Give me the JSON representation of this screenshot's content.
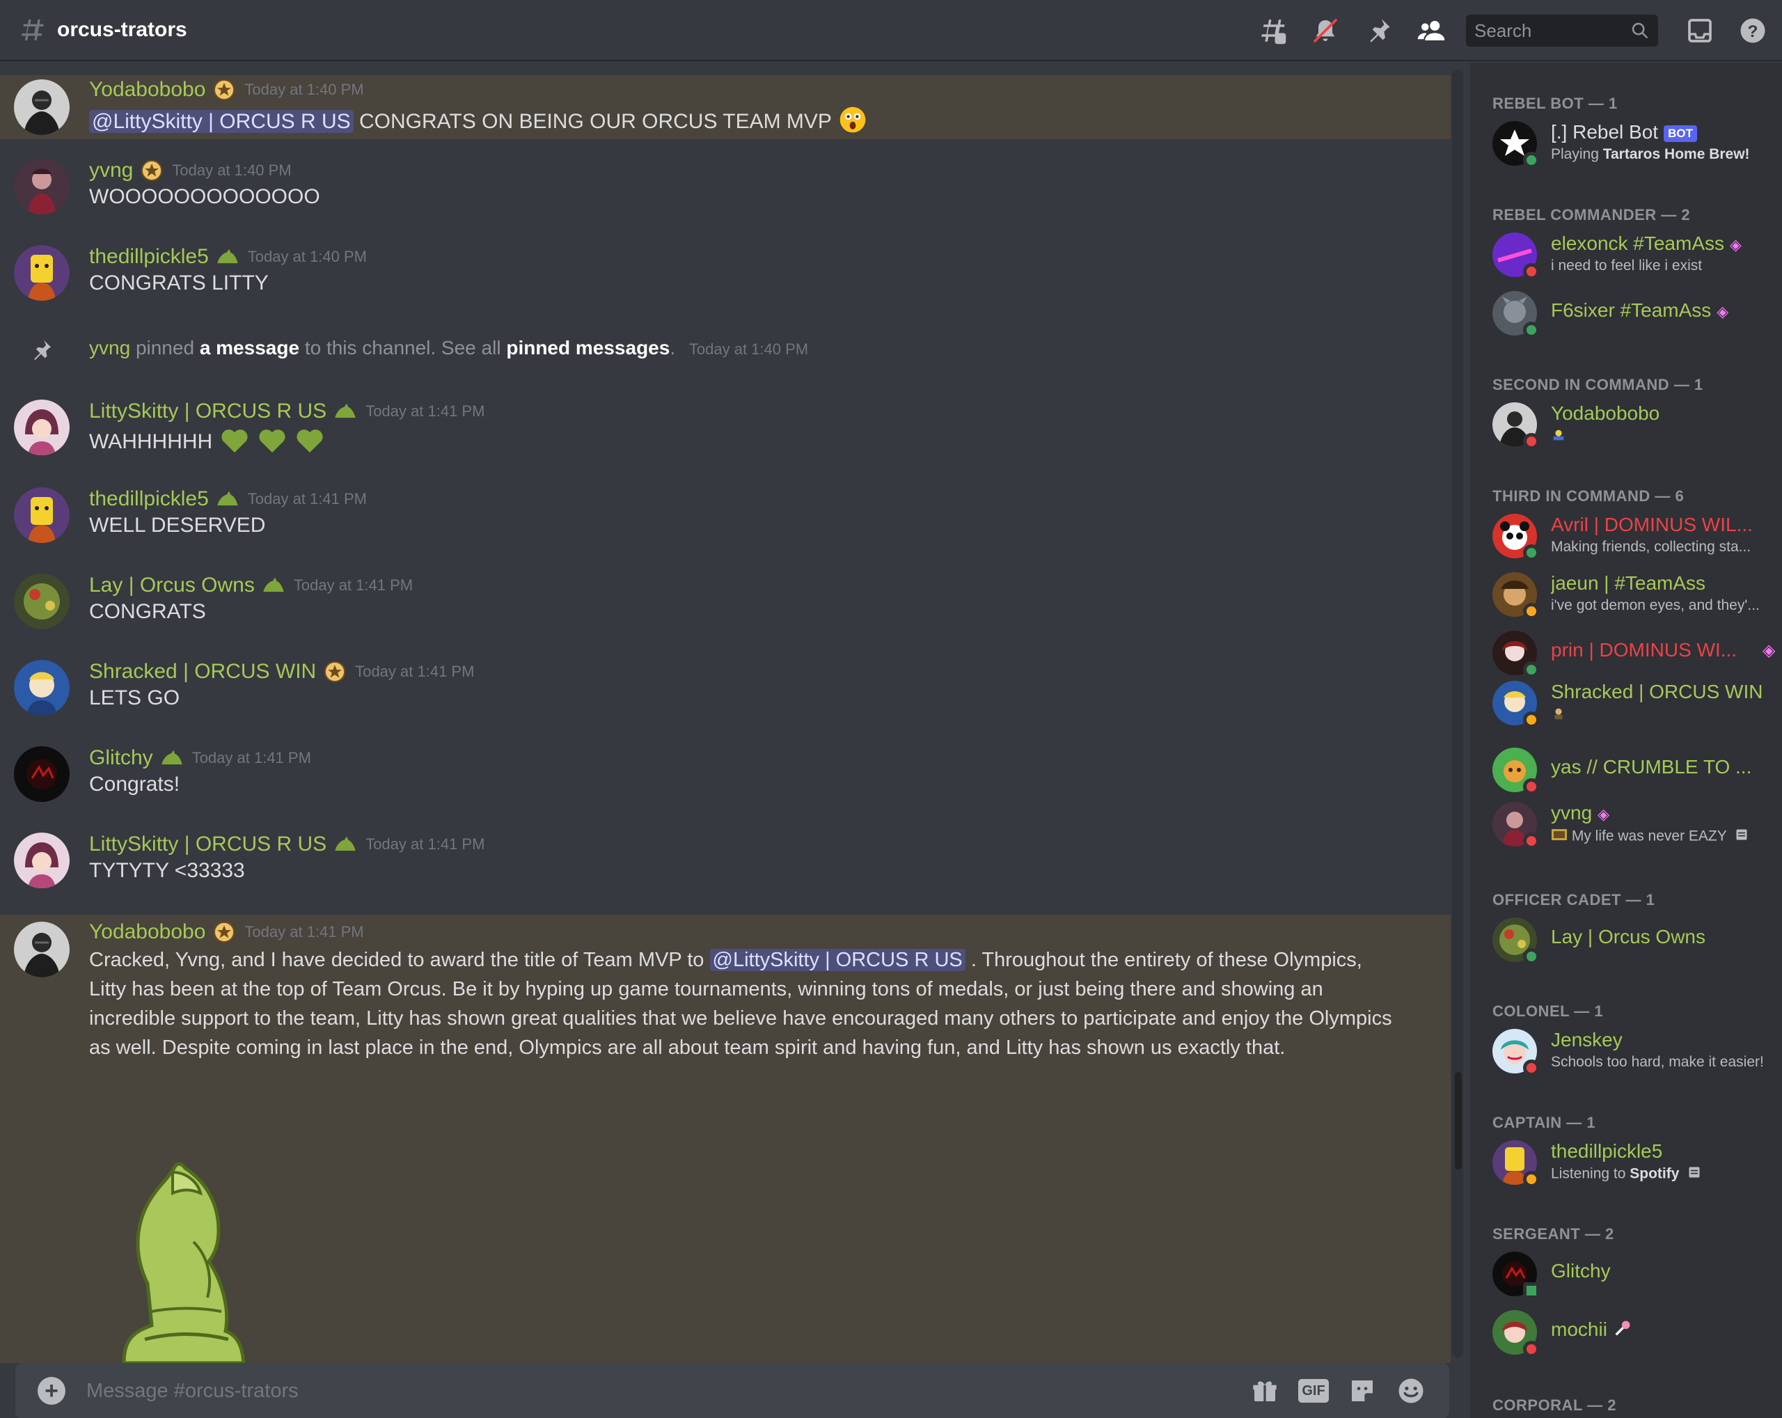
{
  "header": {
    "channel_name": "orcus-trators",
    "search_placeholder": "Search"
  },
  "messages": [
    {
      "author": "Yodabobobo",
      "time": "Today at 1:40 PM",
      "mention": "@LittySkitty | ORCUS R US",
      "text": "CONGRATS ON BEING OUR ORCUS TEAM MVP"
    },
    {
      "author": "yvng",
      "time": "Today at 1:40 PM",
      "text": "WOOOOOOOOOOOOO"
    },
    {
      "author": "thedillpickle5",
      "time": "Today at 1:40 PM",
      "text": "CONGRATS LITTY"
    },
    {
      "author": "LittySkitty | ORCUS R US",
      "time": "Today at 1:41 PM",
      "text": "WAHHHHHH"
    },
    {
      "author": "thedillpickle5",
      "time": "Today at 1:41 PM",
      "text": "WELL DESERVED"
    },
    {
      "author": "Lay | Orcus Owns",
      "time": "Today at 1:41 PM",
      "text": "CONGRATS"
    },
    {
      "author": "Shracked | ORCUS WIN",
      "time": "Today at 1:41 PM",
      "text": "LETS GO"
    },
    {
      "author": "Glitchy",
      "time": "Today at 1:41 PM",
      "text": "Congrats!"
    },
    {
      "author": "LittySkitty | ORCUS R US",
      "time": "Today at 1:41 PM",
      "text": "TYTYTY <33333"
    },
    {
      "author": "Yodabobobo",
      "time": "Today at 1:41 PM",
      "text_before": "Cracked, Yvng, and I have decided to award the title of Team MVP to",
      "mention": "@LittySkitty | ORCUS R US",
      "text_after": ". Throughout the entirety of these Olympics, Litty has been at the top of Team Orcus. Be it by hyping up game tournaments, winning tons of medals, or just being there and showing an incredible support to the team, Litty has shown great qualities that we believe have encouraged many others to participate and enjoy the Olympics as well. Despite coming in last place in the end, Olympics are all about team spirit and having fun, and Litty has shown us exactly that."
    }
  ],
  "pin_notice": {
    "user": "yvng",
    "w1": "pinned",
    "link1": "a message",
    "w2": "to this channel. See all",
    "link2": "pinned messages",
    "w3": ".",
    "time": "Today at 1:40 PM"
  },
  "composer": {
    "placeholder": "Message #orcus-trators",
    "gif_label": "GIF"
  },
  "member_groups": [
    {
      "label": "REBEL BOT — 1",
      "members": [
        {
          "name": "[.] Rebel Bot",
          "badge": "BOT",
          "sub_prefix": "Playing ",
          "sub_bold": "Tartaros Home Brew!"
        }
      ]
    },
    {
      "label": "REBEL COMMANDER — 2",
      "members": [
        {
          "name": "elexonck #TeamAss",
          "sub": "i need to feel like i exist"
        },
        {
          "name": "F6sixer #TeamAss"
        }
      ]
    },
    {
      "label": "SECOND IN COMMAND — 1",
      "members": [
        {
          "name": "Yodabobobo"
        }
      ]
    },
    {
      "label": "THIRD IN COMMAND — 6",
      "members": [
        {
          "name": "Avril | DOMINUS WIL...",
          "sub": "Making friends, collecting sta..."
        },
        {
          "name": "jaeun | #TeamAss",
          "sub": "i've got demon eyes, and they'..."
        },
        {
          "name": "prin | DOMINUS WI..."
        },
        {
          "name": "Shracked | ORCUS WIN"
        },
        {
          "name": "yas // CRUMBLE TO ..."
        },
        {
          "name": "yvng",
          "sub": "My life was never EAZY"
        }
      ]
    },
    {
      "label": "OFFICER CADET — 1",
      "members": [
        {
          "name": "Lay | Orcus Owns"
        }
      ]
    },
    {
      "label": "COLONEL — 1",
      "members": [
        {
          "name": "Jenskey",
          "sub": "Schools too hard, make it easier!"
        }
      ]
    },
    {
      "label": "CAPTAIN — 1",
      "members": [
        {
          "name": "thedillpickle5",
          "sub_prefix": "Listening to ",
          "sub_bold": "Spotify"
        }
      ]
    },
    {
      "label": "SERGEANT — 2",
      "members": [
        {
          "name": "Glitchy"
        },
        {
          "name": "mochii"
        }
      ]
    },
    {
      "label": "CORPORAL — 2",
      "members": []
    }
  ],
  "colors": {
    "username_green": "#a7c957",
    "username_red": "#ed4245",
    "mention_bg": "#5865f2",
    "highlight_bg": "#49443c"
  }
}
